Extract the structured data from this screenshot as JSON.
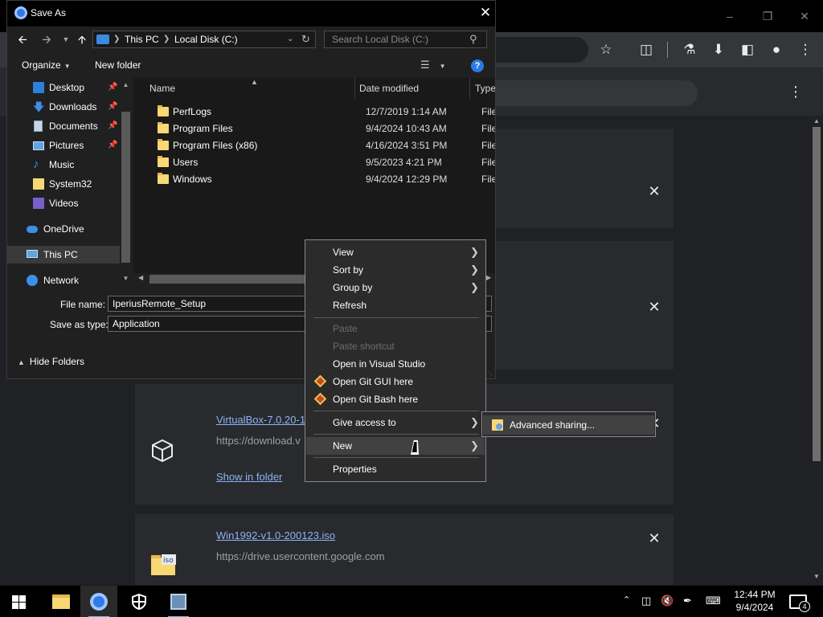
{
  "dialog": {
    "title": "Save As",
    "address": {
      "segments": [
        "This PC",
        "Local Disk (C:)"
      ]
    },
    "search_placeholder": "Search Local Disk (C:)",
    "commands": {
      "organize": "Organize",
      "new_folder": "New folder"
    },
    "nav_items": [
      {
        "label": "Desktop",
        "icon": "desktop-icon",
        "pinned": true
      },
      {
        "label": "Downloads",
        "icon": "downloads-icon",
        "pinned": true
      },
      {
        "label": "Documents",
        "icon": "documents-icon",
        "pinned": true
      },
      {
        "label": "Pictures",
        "icon": "pictures-icon",
        "pinned": true
      },
      {
        "label": "Music",
        "icon": "music-icon",
        "pinned": false
      },
      {
        "label": "System32",
        "icon": "folder-icon",
        "pinned": false
      },
      {
        "label": "Videos",
        "icon": "videos-icon",
        "pinned": false
      },
      {
        "label": "OneDrive",
        "icon": "onedrive-icon",
        "pinned": false
      },
      {
        "label": "This PC",
        "icon": "this-pc-icon",
        "pinned": false,
        "selected": true
      },
      {
        "label": "Network",
        "icon": "network-icon",
        "pinned": false
      }
    ],
    "columns": {
      "name": "Name",
      "date": "Date modified",
      "type": "Type"
    },
    "files": [
      {
        "name": "PerfLogs",
        "date": "12/7/2019 1:14 AM",
        "type": "File fo"
      },
      {
        "name": "Program Files",
        "date": "9/4/2024 10:43 AM",
        "type": "File fo"
      },
      {
        "name": "Program Files (x86)",
        "date": "4/16/2024 3:51 PM",
        "type": "File fo"
      },
      {
        "name": "Users",
        "date": "9/5/2023 4:21 PM",
        "type": "File fo"
      },
      {
        "name": "Windows",
        "date": "9/4/2024 12:29 PM",
        "type": "File fo"
      }
    ],
    "file_name_label": "File name:",
    "file_name_value": "IperiusRemote_Setup",
    "save_type_label": "Save as type:",
    "save_type_value": "Application",
    "hide_folders": "Hide Folders"
  },
  "context_menu": {
    "items": [
      {
        "label": "View",
        "submenu": true,
        "disabled": false
      },
      {
        "label": "Sort by",
        "submenu": true,
        "disabled": false
      },
      {
        "label": "Group by",
        "submenu": true,
        "disabled": false
      },
      {
        "label": "Refresh",
        "submenu": false,
        "disabled": false
      },
      {
        "label": "Paste",
        "submenu": false,
        "disabled": true
      },
      {
        "label": "Paste shortcut",
        "submenu": false,
        "disabled": true
      },
      {
        "label": "Open in Visual Studio",
        "submenu": false,
        "disabled": false
      },
      {
        "label": "Open Git GUI here",
        "submenu": false,
        "disabled": false,
        "icon": "git-icon"
      },
      {
        "label": "Open Git Bash here",
        "submenu": false,
        "disabled": false,
        "icon": "git-icon"
      },
      {
        "label": "Give access to",
        "submenu": true,
        "disabled": false
      },
      {
        "label": "New",
        "submenu": true,
        "disabled": false,
        "hover": true
      },
      {
        "label": "Properties",
        "submenu": false,
        "disabled": false
      }
    ],
    "submenu": {
      "label": "Advanced sharing..."
    }
  },
  "browser": {
    "downloads": [
      {
        "link": "VirtualBox-7.0.20-1",
        "url": "https://download.v",
        "show": "Show in folder"
      },
      {
        "link": "Win1992-v1.0-200123.iso",
        "url": "https://drive.usercontent.google.com"
      }
    ]
  },
  "taskbar": {
    "time": "12:44 PM",
    "date": "9/4/2024",
    "notification_count": "4"
  }
}
